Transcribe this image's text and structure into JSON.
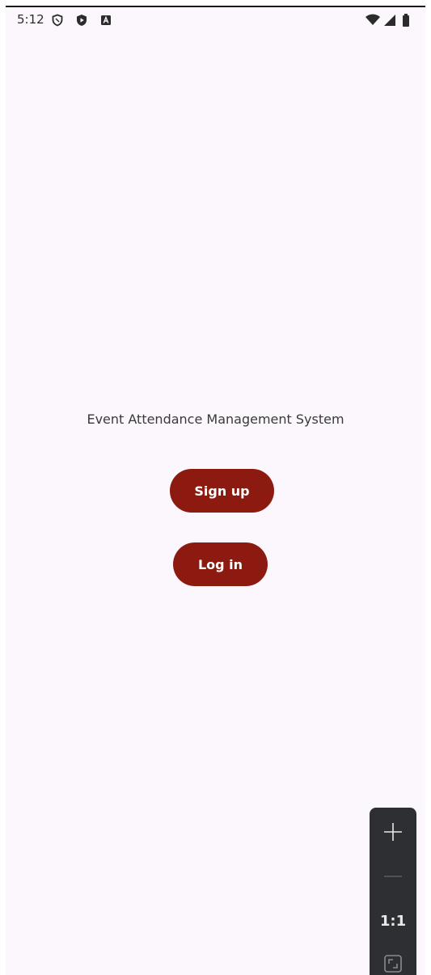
{
  "status_bar": {
    "time": "5:12",
    "left_icons": [
      "shield-icon",
      "play-protect-icon",
      "keyboard-a-icon"
    ],
    "right_icons": [
      "wifi-icon",
      "signal-icon",
      "battery-icon"
    ]
  },
  "main": {
    "title": "Event Attendance Management System",
    "signup_label": "Sign up",
    "login_label": "Log in"
  },
  "zoom_toolbar": {
    "tools": [
      "plus-icon",
      "minus-icon",
      "one-to-one",
      "fit-icon"
    ],
    "one_to_one_label": "1:1"
  },
  "colors": {
    "background": "#fcf6fd",
    "button": "#8c1a10",
    "button_text": "#ffffff",
    "toolbar": "#2e2f33"
  }
}
